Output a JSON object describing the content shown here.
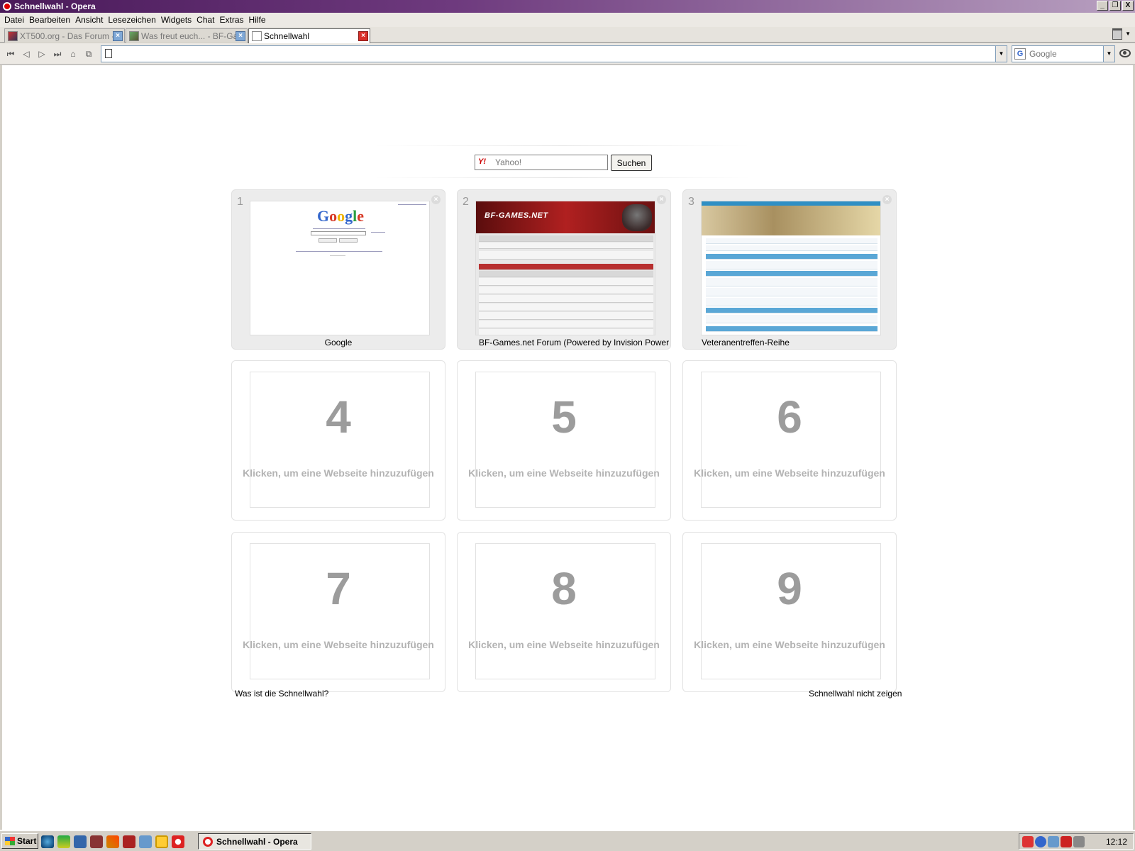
{
  "window": {
    "title": "Schnellwahl - Opera",
    "controls": [
      "_",
      "❐",
      "X"
    ]
  },
  "menu": [
    "Datei",
    "Bearbeiten",
    "Ansicht",
    "Lesezeichen",
    "Widgets",
    "Chat",
    "Extras",
    "Hilfe"
  ],
  "tabs": [
    {
      "label": "XT500.org - Das Forum - ...",
      "active": false
    },
    {
      "label": "Was freut euch... - BF-Ga...",
      "active": false
    },
    {
      "label": "Schnellwahl",
      "active": true
    }
  ],
  "address": {
    "value": "",
    "placeholder": ""
  },
  "search_engine": {
    "label": "Google",
    "icon": "G"
  },
  "yahoo": {
    "placeholder": "Yahoo!",
    "button": "Suchen",
    "icon": "Y!"
  },
  "speed_dial": [
    {
      "number": "1",
      "title": "Google",
      "filled": true
    },
    {
      "number": "2",
      "title": "BF-Games.net Forum (Powered by Invision Power ...",
      "filled": true
    },
    {
      "number": "3",
      "title": "Veteranentreffen-Reihe",
      "filled": true
    },
    {
      "number": "4",
      "add_text": "Klicken, um eine Webseite hinzuzufügen",
      "filled": false
    },
    {
      "number": "5",
      "add_text": "Klicken, um eine Webseite hinzuzufügen",
      "filled": false
    },
    {
      "number": "6",
      "add_text": "Klicken, um eine Webseite hinzuzufügen",
      "filled": false
    },
    {
      "number": "7",
      "add_text": "Klicken, um eine Webseite hinzuzufügen",
      "filled": false
    },
    {
      "number": "8",
      "add_text": "Klicken, um eine Webseite hinzuzufügen",
      "filled": false
    },
    {
      "number": "9",
      "add_text": "Klicken, um eine Webseite hinzuzufügen",
      "filled": false
    }
  ],
  "thumbs": {
    "google_logo": "Google",
    "bf_logo": "BF-GAMES.NET"
  },
  "footer": {
    "what_is": "Was ist die Schnellwahl?",
    "hide": "Schnellwahl nicht zeigen"
  },
  "taskbar": {
    "start": "Start",
    "task": "Schnellwahl - Opera",
    "clock": "12:12"
  }
}
